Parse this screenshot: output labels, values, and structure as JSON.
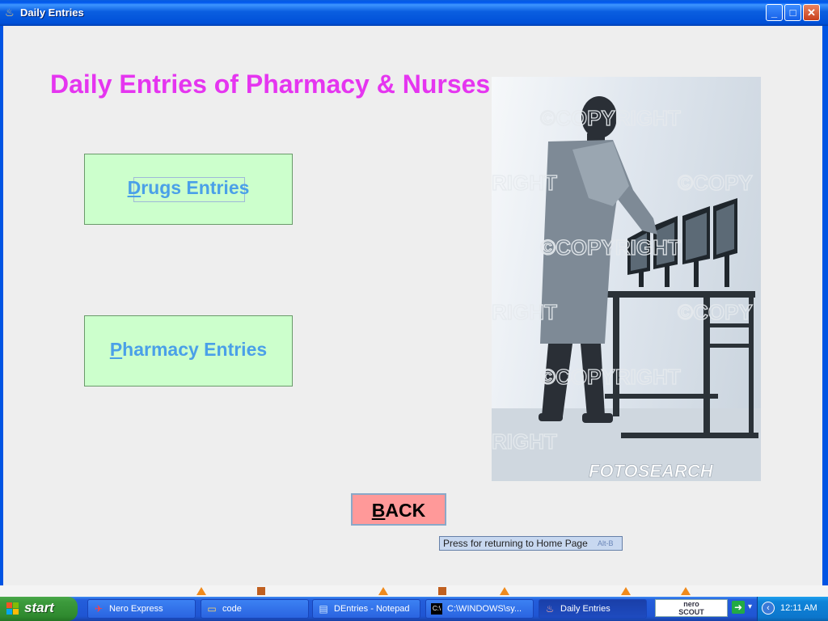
{
  "window": {
    "title": "Daily Entries",
    "icon": "java-cup-icon",
    "controls": [
      "minimize",
      "maximize",
      "close"
    ]
  },
  "main": {
    "heading": "Daily Entries of Pharmacy & Nurses",
    "drugs_button": {
      "mnemonic": "D",
      "rest": "rugs Entries"
    },
    "pharmacy_button": {
      "mnemonic": "P",
      "rest": "harmacy Entries"
    },
    "back_button": {
      "mnemonic": "B",
      "rest": "ACK"
    },
    "tooltip": {
      "text": "Press for returning to Home Page",
      "shortcut": "Alt-B"
    },
    "photo": {
      "watermarks": [
        "©COPYRIGHT",
        "©COPY",
        "RIGHT",
        "©COPYRIGHT",
        "RIGHT",
        "©COPY",
        "©COPYRIGHT",
        "RIGHT"
      ],
      "brand": "FOTOSEARCH"
    }
  },
  "colors": {
    "heading": "#e535f0",
    "button_bg": "#ccffcc",
    "button_text": "#4aa0e8",
    "back_bg": "#ff9999"
  },
  "taskbar": {
    "start_label": "start",
    "tasks": [
      {
        "label": "Nero Express",
        "icon": "nero-icon"
      },
      {
        "label": "code",
        "icon": "folder-icon"
      },
      {
        "label": "DEntries - Notepad",
        "icon": "notepad-icon"
      },
      {
        "label": "C:\\WINDOWS\\sy...",
        "icon": "cmd-icon"
      },
      {
        "label": "Daily Entries",
        "icon": "java-cup-icon",
        "active": true
      }
    ],
    "nero_scout": {
      "line1": "nero",
      "line2": "SCOUT"
    },
    "clock": "12:11 AM"
  }
}
